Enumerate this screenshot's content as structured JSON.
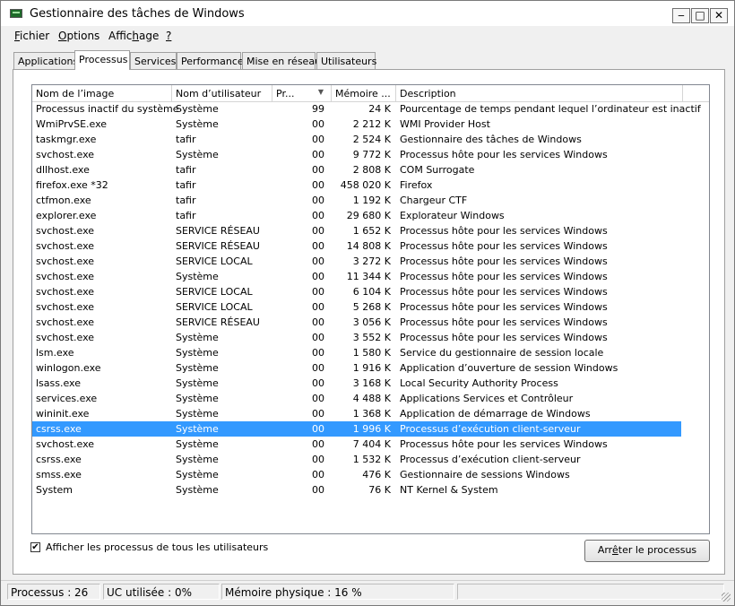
{
  "window": {
    "title": "Gestionnaire des tâches de Windows"
  },
  "menu": {
    "file": {
      "pre": "",
      "key": "F",
      "post": "ichier"
    },
    "options": {
      "pre": "",
      "key": "O",
      "post": "ptions"
    },
    "view": {
      "pre": "Affic",
      "key": "h",
      "post": "age"
    },
    "help": {
      "pre": "",
      "key": "?",
      "post": ""
    }
  },
  "tabs": [
    "Applications",
    "Processus",
    "Services",
    "Performance",
    "Mise en réseau",
    "Utilisateurs"
  ],
  "active_tab": "Processus",
  "columns": {
    "name": "Nom de l’image",
    "user": "Nom d’utilisateur",
    "cpu": "Pr...",
    "memory": "Mémoire ...",
    "description": "Description"
  },
  "sort": {
    "column": "cpu",
    "direction": "descending"
  },
  "processes": [
    {
      "name": "Processus inactif du système",
      "user": "Système",
      "cpu": "99",
      "memory": "24 K",
      "description": "Pourcentage de temps pendant lequel l’ordinateur est inactif"
    },
    {
      "name": "WmiPrvSE.exe",
      "user": "Système",
      "cpu": "00",
      "memory": "2 212 K",
      "description": "WMI Provider Host"
    },
    {
      "name": "taskmgr.exe",
      "user": "tafir",
      "cpu": "00",
      "memory": "2 524 K",
      "description": "Gestionnaire des tâches de Windows"
    },
    {
      "name": "svchost.exe",
      "user": "Système",
      "cpu": "00",
      "memory": "9 772 K",
      "description": "Processus hôte pour les services Windows"
    },
    {
      "name": "dllhost.exe",
      "user": "tafir",
      "cpu": "00",
      "memory": "2 808 K",
      "description": "COM Surrogate"
    },
    {
      "name": "firefox.exe *32",
      "user": "tafir",
      "cpu": "00",
      "memory": "458 020 K",
      "description": "Firefox"
    },
    {
      "name": "ctfmon.exe",
      "user": "tafir",
      "cpu": "00",
      "memory": "1 192 K",
      "description": "Chargeur CTF"
    },
    {
      "name": "explorer.exe",
      "user": "tafir",
      "cpu": "00",
      "memory": "29 680 K",
      "description": "Explorateur Windows"
    },
    {
      "name": "svchost.exe",
      "user": "SERVICE RÉSEAU",
      "cpu": "00",
      "memory": "1 652 K",
      "description": "Processus hôte pour les services Windows"
    },
    {
      "name": "svchost.exe",
      "user": "SERVICE RÉSEAU",
      "cpu": "00",
      "memory": "14 808 K",
      "description": "Processus hôte pour les services Windows"
    },
    {
      "name": "svchost.exe",
      "user": "SERVICE LOCAL",
      "cpu": "00",
      "memory": "3 272 K",
      "description": "Processus hôte pour les services Windows"
    },
    {
      "name": "svchost.exe",
      "user": "Système",
      "cpu": "00",
      "memory": "11 344 K",
      "description": "Processus hôte pour les services Windows"
    },
    {
      "name": "svchost.exe",
      "user": "SERVICE LOCAL",
      "cpu": "00",
      "memory": "6 104 K",
      "description": "Processus hôte pour les services Windows"
    },
    {
      "name": "svchost.exe",
      "user": "SERVICE LOCAL",
      "cpu": "00",
      "memory": "5 268 K",
      "description": "Processus hôte pour les services Windows"
    },
    {
      "name": "svchost.exe",
      "user": "SERVICE RÉSEAU",
      "cpu": "00",
      "memory": "3 056 K",
      "description": "Processus hôte pour les services Windows"
    },
    {
      "name": "svchost.exe",
      "user": "Système",
      "cpu": "00",
      "memory": "3 552 K",
      "description": "Processus hôte pour les services Windows"
    },
    {
      "name": "lsm.exe",
      "user": "Système",
      "cpu": "00",
      "memory": "1 580 K",
      "description": "Service du gestionnaire de session locale"
    },
    {
      "name": "winlogon.exe",
      "user": "Système",
      "cpu": "00",
      "memory": "1 916 K",
      "description": "Application d’ouverture de session Windows"
    },
    {
      "name": "lsass.exe",
      "user": "Système",
      "cpu": "00",
      "memory": "3 168 K",
      "description": "Local Security Authority Process"
    },
    {
      "name": "services.exe",
      "user": "Système",
      "cpu": "00",
      "memory": "4 488 K",
      "description": "Applications Services et Contrôleur"
    },
    {
      "name": "wininit.exe",
      "user": "Système",
      "cpu": "00",
      "memory": "1 368 K",
      "description": "Application de démarrage de Windows"
    },
    {
      "name": "csrss.exe",
      "user": "Système",
      "cpu": "00",
      "memory": "1 996 K",
      "description": "Processus d’exécution client-serveur",
      "selected": true
    },
    {
      "name": "svchost.exe",
      "user": "Système",
      "cpu": "00",
      "memory": "7 404 K",
      "description": "Processus hôte pour les services Windows"
    },
    {
      "name": "csrss.exe",
      "user": "Système",
      "cpu": "00",
      "memory": "1 532 K",
      "description": "Processus d’exécution client-serveur"
    },
    {
      "name": "smss.exe",
      "user": "Système",
      "cpu": "00",
      "memory": "476 K",
      "description": "Gestionnaire de sessions Windows"
    },
    {
      "name": "System",
      "user": "Système",
      "cpu": "00",
      "memory": "76 K",
      "description": "NT Kernel & System"
    }
  ],
  "show_all_users": {
    "checked": true,
    "label": "Afficher les processus de tous les utilisateurs"
  },
  "end_process_button": {
    "pre": "Arr",
    "key": "ê",
    "post": "ter le processus"
  },
  "status": {
    "processes": "Processus : 26",
    "cpu": "UC utilisée : 0%",
    "memory": "Mémoire physique : 16 %"
  },
  "colors": {
    "selection": "#3399ff",
    "selection_text": "#ffffff"
  }
}
